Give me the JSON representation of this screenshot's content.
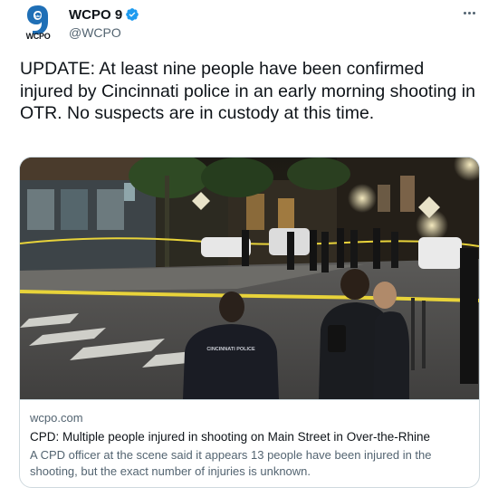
{
  "author": {
    "display_name": "WCPO 9",
    "handle": "@WCPO",
    "avatar_icon": "wcpo-abc-logo-icon",
    "avatar_numeral": "9",
    "avatar_network": "abc",
    "avatar_wordmark": "WCPO",
    "verified_icon": "verified-badge-icon",
    "verified_color": "#1d9bf0"
  },
  "menu": {
    "more_icon": "more-options-icon"
  },
  "tweet": {
    "text": "UPDATE: At least nine people have been confirmed injured by Cincinnati police in an early morning shooting in OTR. No suspects are in custody at this time."
  },
  "card": {
    "domain": "wcpo.com",
    "title": "CPD: Multiple people injured in shooting on Main Street in Over-the-Rhine",
    "description": "A CPD officer at the scene said it appears 13 people have been injured in the shooting, but the exact number of injuries is unknown.",
    "image": {
      "description": "Night street scene with police officers and yellow tape",
      "police_jacket_text": "CINCINNATI POLICE"
    }
  },
  "colors": {
    "text_primary": "#0f1419",
    "text_secondary": "#536471",
    "border": "#cfd9de",
    "brand_blue": "#1f6fb6"
  }
}
